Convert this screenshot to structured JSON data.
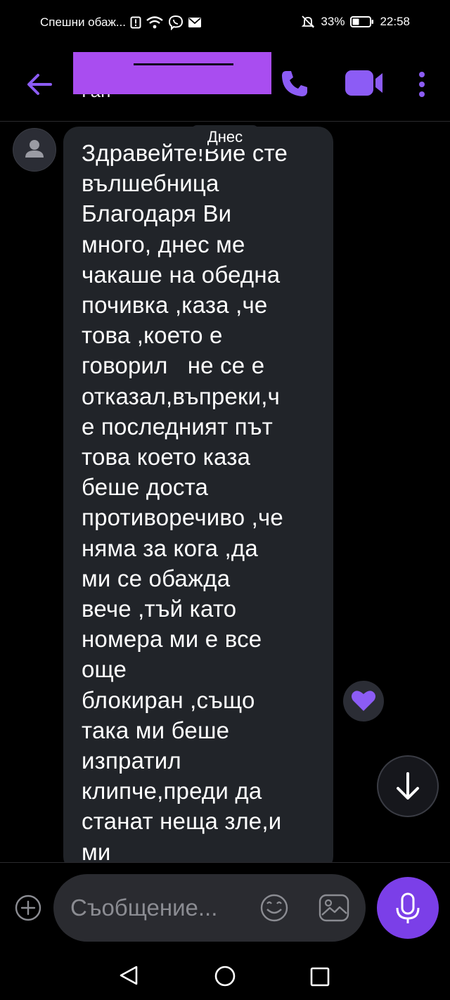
{
  "status_bar": {
    "carrier": "Спешни обаж...",
    "battery": "33%",
    "time": "22:58"
  },
  "header": {
    "contact_name": "Ган"
  },
  "chat": {
    "date_chip": "Днес",
    "message": "Здравейте!Вие сте\nвълшебница\nБлагодаря Ви\nмного, днес ме\nчакаше на обедна\nпочивка ,каза ,че\nтова ,което е\nговорил   не се е\nотказал,въпреки,ч\nе последният път\nтова което каза\nбеше доста\nпротиворечиво ,че\nняма за кога ,да\nми се обажда\nвече ,тъй като\nномера ми е все\nоще\nблокиран ,също\nтака ми беше\nизпратил\nклипче,преди да\nстанат неща зле,и\nми"
  },
  "composer": {
    "placeholder": "Съобщение..."
  },
  "colors": {
    "accent": "#7b3fe8",
    "icon_purple": "#8c5cf5",
    "bubble": "#212429",
    "background": "#000000"
  },
  "icons": [
    "back-arrow-icon",
    "phone-icon",
    "video-icon",
    "more-vert-icon",
    "avatar-icon",
    "heart-icon",
    "arrow-down-icon",
    "add-icon",
    "emoji-icon",
    "gallery-icon",
    "mic-icon"
  ]
}
